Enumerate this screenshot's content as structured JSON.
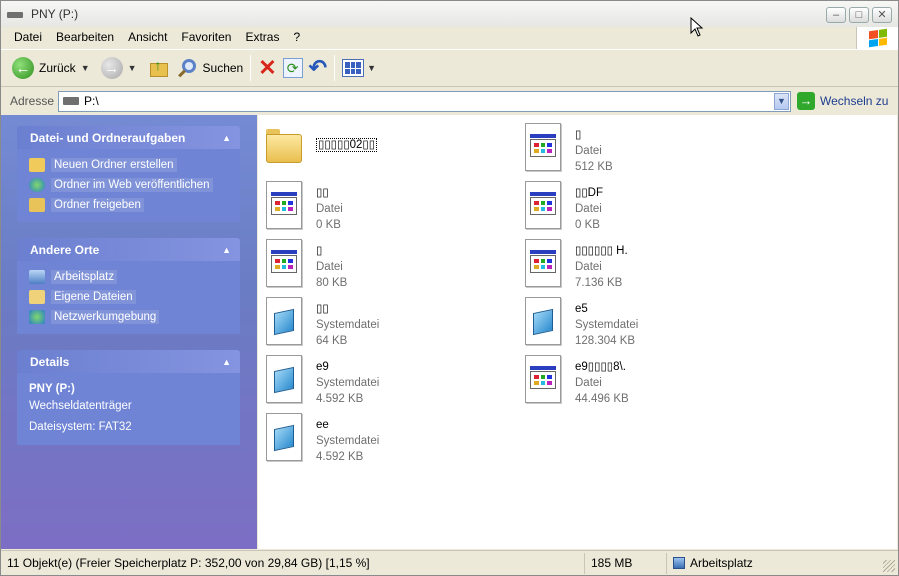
{
  "window": {
    "title": "PNY (P:)",
    "controls": [
      "minimize",
      "maximize",
      "close"
    ]
  },
  "menu": [
    "Datei",
    "Bearbeiten",
    "Ansicht",
    "Favoriten",
    "Extras",
    "?"
  ],
  "toolbar": {
    "back_label": "Zurück",
    "search_label": "Suchen"
  },
  "address": {
    "label": "Adresse",
    "value": "P:\\",
    "go_label": "Wechseln zu"
  },
  "taskpane": {
    "tasks": {
      "title": "Datei- und Ordneraufgaben",
      "items": [
        "Neuen Ordner erstellen",
        "Ordner im Web veröffentlichen",
        "Ordner freigeben"
      ]
    },
    "places": {
      "title": "Andere Orte",
      "items": [
        "Arbeitsplatz",
        "Eigene Dateien",
        "Netzwerkumgebung"
      ]
    },
    "details": {
      "title": "Details",
      "name": "PNY (P:)",
      "type": "Wechseldatenträger",
      "filesystem": "Dateisystem: FAT32"
    }
  },
  "files": [
    {
      "name": "▯▯▯▯▯02▯▯",
      "type": "",
      "size": "",
      "icon": "folder-icon"
    },
    {
      "name": "▯",
      "type": "Datei",
      "size": "512 KB",
      "icon": "file-icon"
    },
    {
      "name": "▯▯",
      "type": "Datei",
      "size": "0 KB",
      "icon": "file-icon"
    },
    {
      "name": "▯▯DF",
      "type": "Datei",
      "size": "0 KB",
      "icon": "file-icon"
    },
    {
      "name": "▯",
      "type": "Datei",
      "size": "80 KB",
      "icon": "file-icon"
    },
    {
      "name": "▯▯▯▯▯▯ H.",
      "type": "Datei",
      "size": "7.136 KB",
      "icon": "file-icon"
    },
    {
      "name": "▯▯",
      "type": "Systemdatei",
      "size": "64 KB",
      "icon": "system-file-icon"
    },
    {
      "name": "e5",
      "type": "Systemdatei",
      "size": "128.304 KB",
      "icon": "system-file-icon"
    },
    {
      "name": "e9",
      "type": "Systemdatei",
      "size": "4.592 KB",
      "icon": "system-file-icon"
    },
    {
      "name": "e9▯▯▯▯8\\.",
      "type": "Datei",
      "size": "44.496 KB",
      "icon": "file-icon"
    },
    {
      "name": "ee",
      "type": "Systemdatei",
      "size": "4.592 KB",
      "icon": "system-file-icon"
    }
  ],
  "status": {
    "objects": "11 Objekt(e) (Freier Speicherplatz P: 352,00 von 29,84 GB) [1,15 %]",
    "size": "185 MB",
    "location": "Arbeitsplatz"
  }
}
